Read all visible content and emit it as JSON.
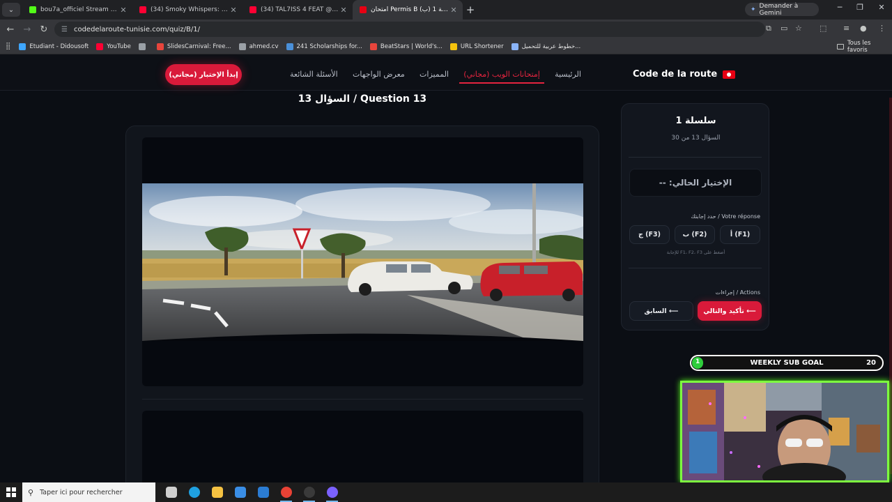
{
  "browser": {
    "tabs": [
      {
        "title": "bou7a_officiel Stream - Watch",
        "favicon_color": "#53fc18",
        "active": false
      },
      {
        "title": "(34) Smoky Whispers: A Lat",
        "favicon_color": "#ff0033",
        "active": false
      },
      {
        "title": "(34) TAL7ISS 4 FEAT @Dahmac",
        "favicon_color": "#ff0033",
        "active": false
      },
      {
        "title": "امتحان Permis B (ب) سلسلة 1 –",
        "favicon_color": "#e70013",
        "active": true
      }
    ],
    "new_tab": "+",
    "gemini_label": "Demander à Gemini",
    "url": "codedelaroute-tunisie.com/quiz/B/1/",
    "bookmarks": [
      {
        "label": "Etudiant - Didousoft",
        "color": "#3ea6ff"
      },
      {
        "label": "YouTube",
        "color": "#ff0033"
      },
      {
        "label": "",
        "color": "#9aa0a6"
      },
      {
        "label": "SlidesCarnival: Free...",
        "color": "#e8453c"
      },
      {
        "label": "ahmed.cv",
        "color": "#9aa0a6"
      },
      {
        "label": "241 Scholarships for...",
        "color": "#4a90d9"
      },
      {
        "label": "BeatStars | World's...",
        "color": "#e8453c"
      },
      {
        "label": "URL Shortener",
        "color": "#f4c20d"
      },
      {
        "label": "خطوط عربية للتحميل...",
        "color": "#8ab4f8"
      }
    ],
    "all_bookmarks": "Tous les favoris"
  },
  "site": {
    "brand": "Code de la route",
    "nav": [
      {
        "label": "الرئيسية",
        "active": false
      },
      {
        "label": "إمتحانات الويب (مجاني)",
        "active": true
      },
      {
        "label": "المميزات",
        "active": false
      },
      {
        "label": "معرض الواجهات",
        "active": false
      },
      {
        "label": "الأسئلة الشائعة",
        "active": false
      }
    ],
    "cta": "إبدأ الإختبار (مجاني)",
    "accent": "#d91a3a"
  },
  "quiz": {
    "question_title": "السؤال 13 / Question 13",
    "panel": {
      "series": "سلسلة 1",
      "progress": "السؤال 13 من 30",
      "current_choice": "الإختيار الحالي: --",
      "answer_label": "حدد إجابتك / Votre réponse",
      "answers": [
        {
          "label": "أ (F1)"
        },
        {
          "label": "ب (F2)"
        },
        {
          "label": "ج (F3)"
        }
      ],
      "hint": "أضغط على F1، F2، F3 للإجابة",
      "actions_label": "إجراءات / Actions",
      "prev_label": "السابق ⟵",
      "next_label": "تأكيد والتالي ⟵"
    }
  },
  "stream_overlay": {
    "goal_current": "1",
    "goal_label": "WEEKLY SUB GOAL",
    "goal_max": "20",
    "goal_progress": 0.05
  },
  "taskbar": {
    "search_placeholder": "Taper ici pour rechercher",
    "apps": [
      {
        "name": "task-view",
        "color": "#cfcfcf"
      },
      {
        "name": "edge",
        "color": "#1fa0e0"
      },
      {
        "name": "file-explorer",
        "color": "#f5c242"
      },
      {
        "name": "store",
        "color": "#3a8ee6"
      },
      {
        "name": "outlook",
        "color": "#2b7cd3"
      },
      {
        "name": "chrome",
        "color": "#e94235"
      },
      {
        "name": "obs",
        "color": "#3a3a3a"
      },
      {
        "name": "discord",
        "color": "#7b61ff"
      }
    ]
  }
}
